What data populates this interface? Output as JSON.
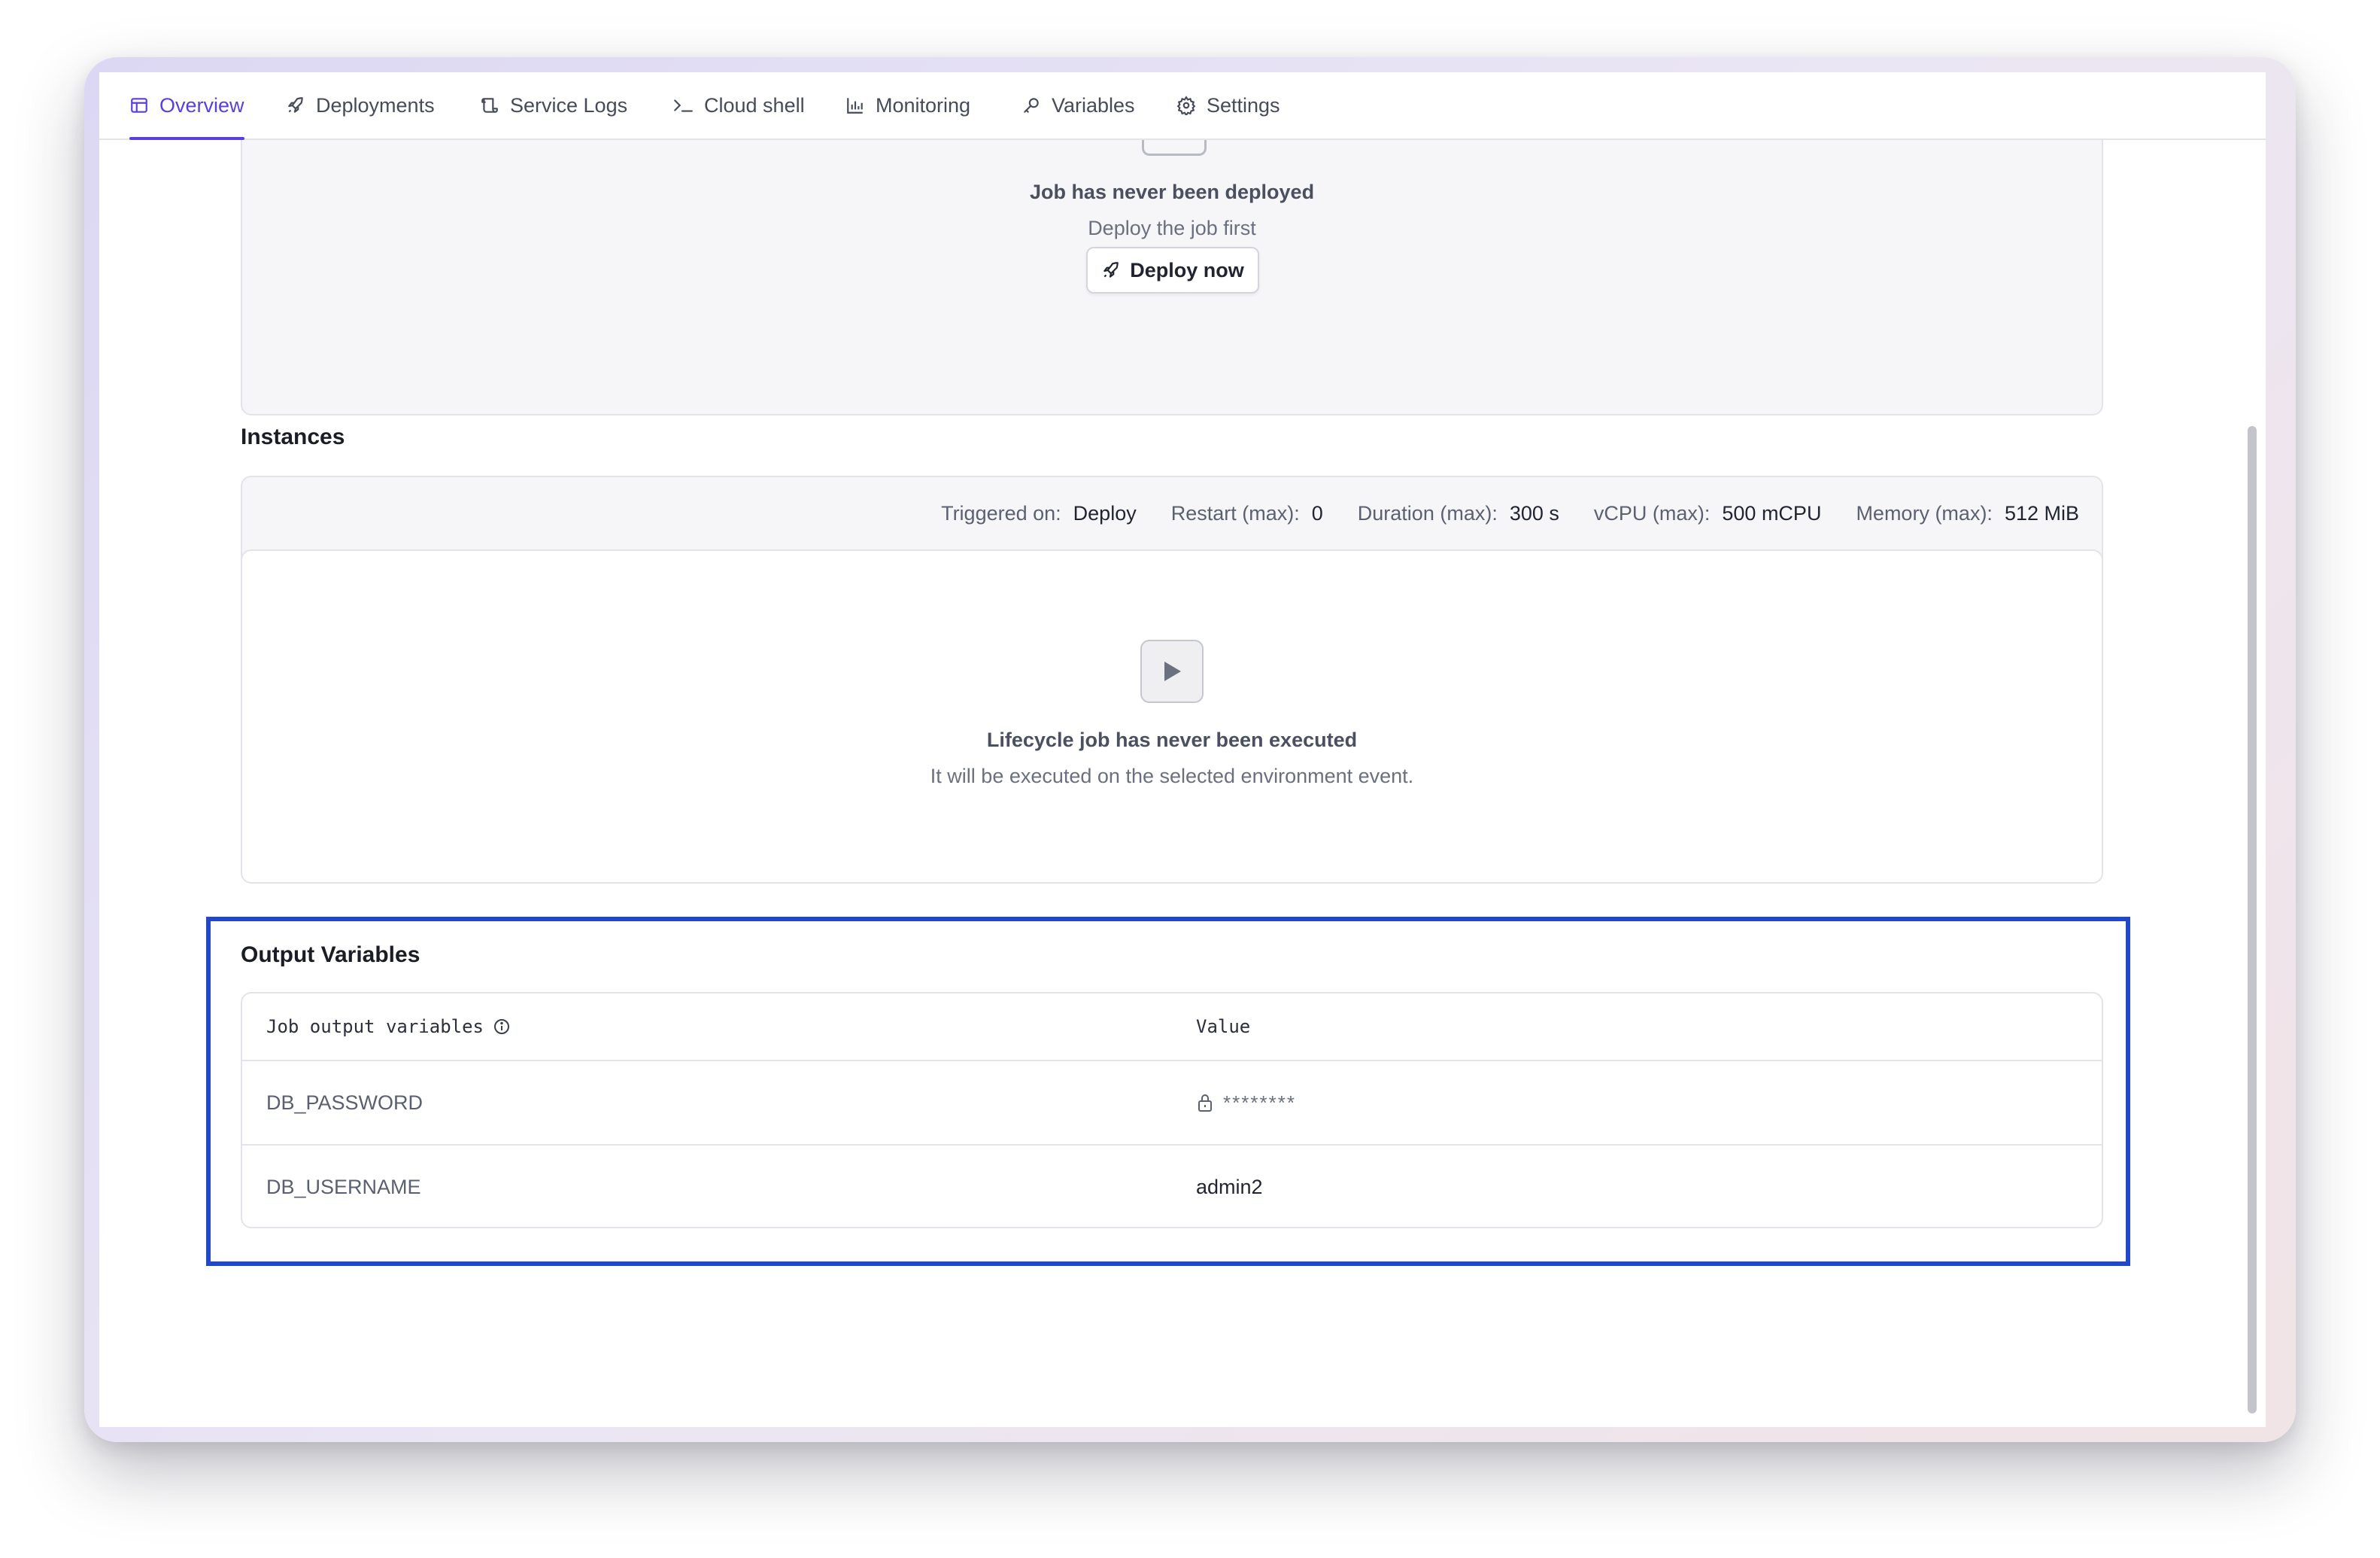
{
  "tabs": [
    {
      "label": "Overview",
      "icon": "layout-icon",
      "active": true
    },
    {
      "label": "Deployments",
      "icon": "rocket-icon",
      "active": false
    },
    {
      "label": "Service Logs",
      "icon": "scroll-icon",
      "active": false
    },
    {
      "label": "Cloud shell",
      "icon": "terminal-icon",
      "active": false
    },
    {
      "label": "Monitoring",
      "icon": "chart-icon",
      "active": false
    },
    {
      "label": "Variables",
      "icon": "key-icon",
      "active": false
    },
    {
      "label": "Settings",
      "icon": "gear-icon",
      "active": false
    }
  ],
  "deploy_card": {
    "title": "Job has never been deployed",
    "subtitle": "Deploy the job first",
    "button_label": "Deploy now"
  },
  "instances": {
    "title": "Instances",
    "meta": [
      {
        "label": "Triggered on:",
        "value": "Deploy"
      },
      {
        "label": "Restart (max):",
        "value": "0"
      },
      {
        "label": "Duration (max):",
        "value": "300 s"
      },
      {
        "label": "vCPU (max):",
        "value": "500 mCPU"
      },
      {
        "label": "Memory (max):",
        "value": "512 MiB"
      }
    ],
    "empty_title": "Lifecycle job has never been executed",
    "empty_subtitle": "It will be executed on the selected environment event."
  },
  "output_variables": {
    "title": "Output Variables",
    "header_name": "Job output variables",
    "header_value": "Value",
    "rows": [
      {
        "name": "DB_PASSWORD",
        "value": "********",
        "secret": true
      },
      {
        "name": "DB_USERNAME",
        "value": "admin2",
        "secret": false
      }
    ]
  },
  "colors": {
    "accent": "#5b3ee0",
    "highlight": "#2048c8"
  }
}
